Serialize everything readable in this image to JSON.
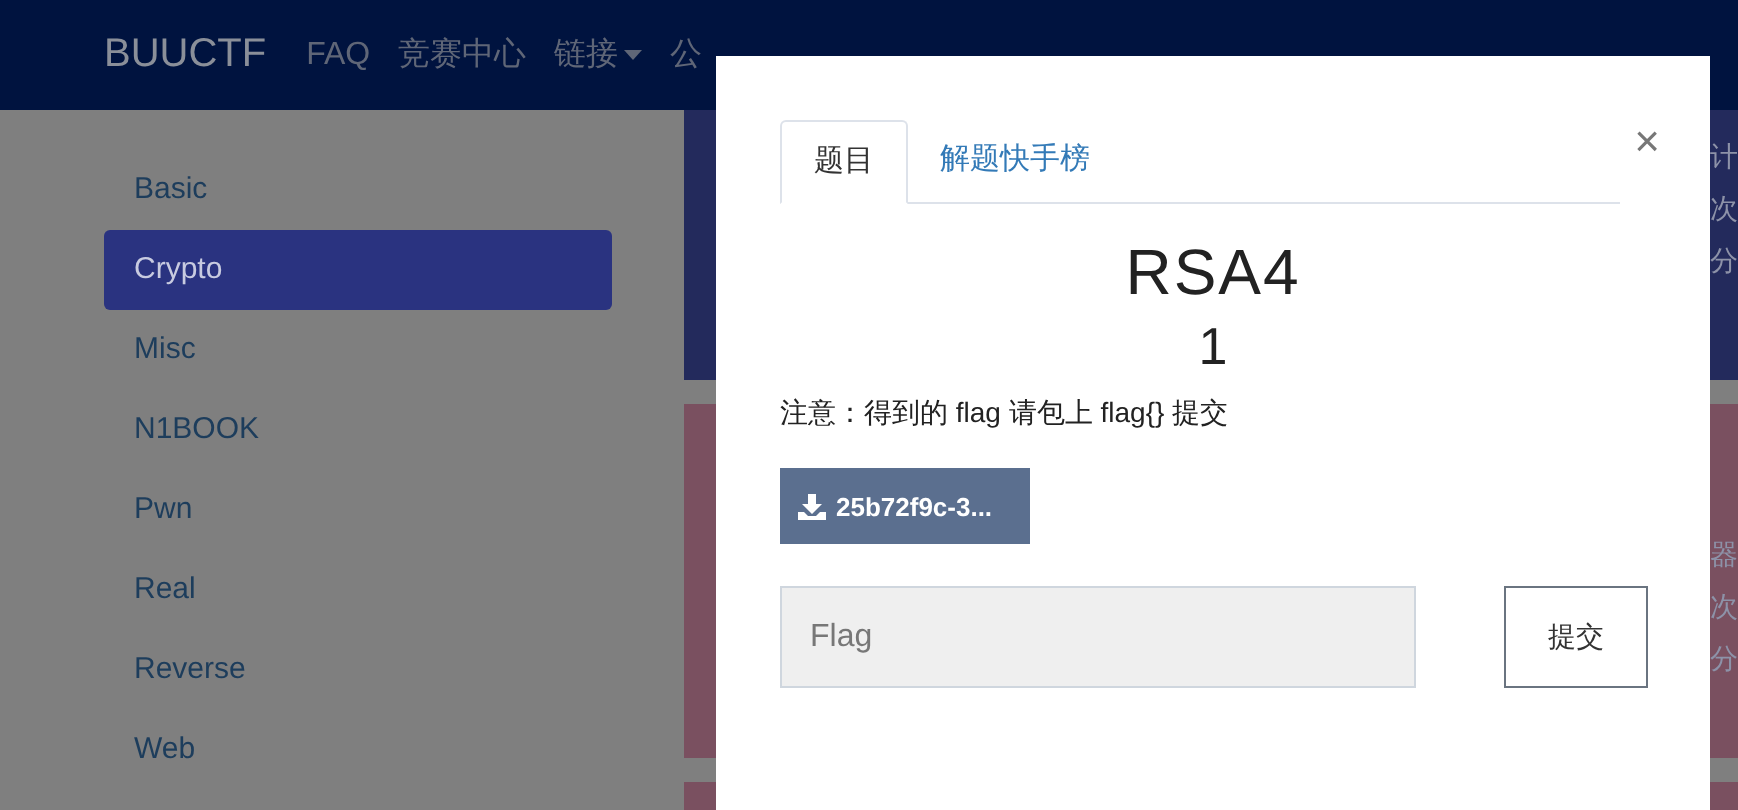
{
  "navbar": {
    "brand": "BUUCTF",
    "items": [
      {
        "label": "FAQ",
        "dropdown": false
      },
      {
        "label": "竞赛中心",
        "dropdown": false
      },
      {
        "label": "链接",
        "dropdown": true
      },
      {
        "label": "公",
        "dropdown": false
      }
    ]
  },
  "sidebar": {
    "items": [
      {
        "label": "Basic",
        "selected": false
      },
      {
        "label": "Crypto",
        "selected": true
      },
      {
        "label": "Misc",
        "selected": false
      },
      {
        "label": "N1BOOK",
        "selected": false
      },
      {
        "label": "Pwn",
        "selected": false
      },
      {
        "label": "Real",
        "selected": false
      },
      {
        "label": "Reverse",
        "selected": false
      },
      {
        "label": "Web",
        "selected": false
      }
    ]
  },
  "cards": [
    {
      "color": "#232a5c",
      "lines": [
        "计",
        "次",
        "分"
      ]
    },
    {
      "color": "#7a5060",
      "lines": [
        "器",
        "次",
        "分"
      ]
    },
    {
      "color": "#7a5060"
    }
  ],
  "modal": {
    "tabs": [
      {
        "label": "题目",
        "selected": true
      },
      {
        "label": "解题快手榜",
        "selected": false
      }
    ],
    "close": "×",
    "title": "RSA4",
    "points": "1",
    "note": "注意：得到的 flag 请包上 flag{} 提交",
    "file_button": "25b72f9c-3...",
    "flag_field": {
      "placeholder": "Flag"
    },
    "submit": "提交"
  }
}
